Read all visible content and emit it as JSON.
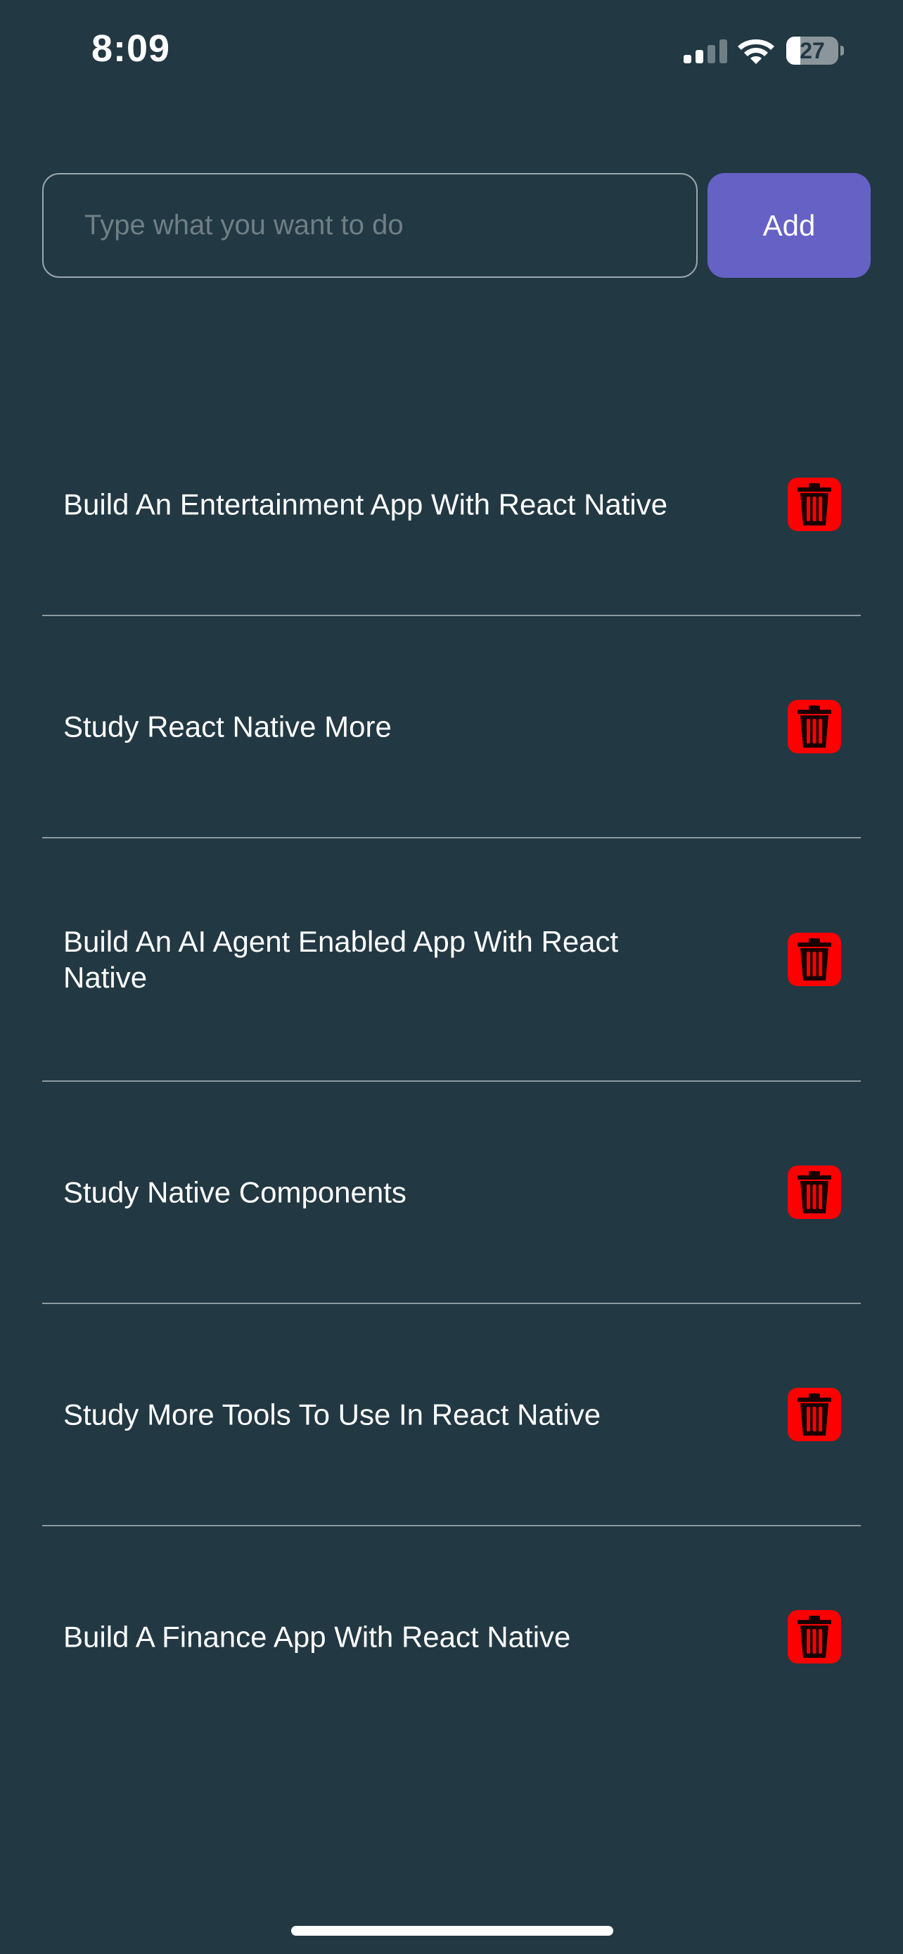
{
  "status_bar": {
    "time": "8:09",
    "battery_level": "27",
    "battery_fraction": 0.27,
    "icons": [
      "signal-icon",
      "wifi-icon",
      "battery-icon"
    ]
  },
  "input": {
    "value": "",
    "placeholder": "Type what you want to do"
  },
  "add_button": {
    "label": "Add"
  },
  "colors": {
    "background": "#223843",
    "accent": "#6661c5",
    "delete": "#ff0000",
    "divider": "#8c9aa0"
  },
  "todos": [
    {
      "text": "Build An Entertainment App With React Native"
    },
    {
      "text": "Study React Native More"
    },
    {
      "text": "Build An AI Agent Enabled App With React Native"
    },
    {
      "text": "Study Native Components"
    },
    {
      "text": "Study More Tools To Use In React Native"
    },
    {
      "text": "Build A Finance App With React Native"
    }
  ]
}
